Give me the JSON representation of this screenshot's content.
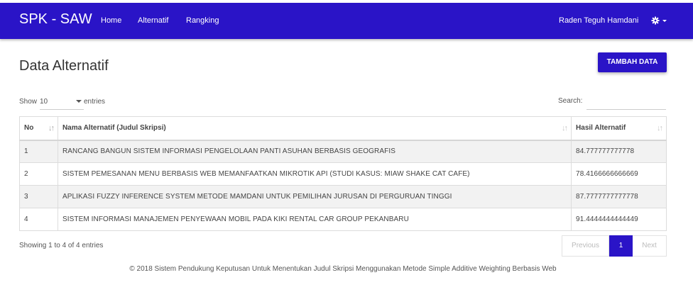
{
  "navbar": {
    "brand": "SPK - SAW",
    "links": [
      "Home",
      "Alternatif",
      "Rangking"
    ],
    "user": "Raden Teguh Hamdani",
    "settings_icon": "gear-icon",
    "color": "#2a14c7"
  },
  "page": {
    "title": "Data Alternatif",
    "add_button": "TAMBAH DATA"
  },
  "table_controls": {
    "show_label": "Show",
    "page_length": "10",
    "entries_label": "entries",
    "search_label": "Search:",
    "search_value": ""
  },
  "table": {
    "headers": [
      "No",
      "Nama Alternatif (Judul Skripsi)",
      "Hasil Alternatif"
    ],
    "rows": [
      [
        "1",
        "RANCANG BANGUN SISTEM INFORMASI PENGELOLAAN PANTI ASUHAN BERBASIS GEOGRAFIS",
        "84.777777777778"
      ],
      [
        "2",
        "SISTEM PEMESANAN MENU BERBASIS WEB MEMANFAATKAN MIKROTIK API (STUDI KASUS: MIAW SHAKE CAT CAFE)",
        "78.4166666666669"
      ],
      [
        "3",
        "APLIKASI FUZZY INFERENCE SYSTEM METODE MAMDANI UNTUK PEMILIHAN JURUSAN DI PERGURUAN TINGGI",
        "87.7777777777778"
      ],
      [
        "4",
        "SISTEM INFORMASI MANAJEMEN PENYEWAAN MOBIL PADA KIKI RENTAL CAR GROUP PEKANBARU",
        "91.4444444444449"
      ]
    ]
  },
  "pagination": {
    "info": "Showing 1 to 4 of 4 entries",
    "previous": "Previous",
    "current": "1",
    "next": "Next"
  },
  "footer": "© 2018 Sistem Pendukung Keputusan Untuk Menentukan Judul Skripsi Menggunakan Metode Simple Additive Weighting Berbasis Web"
}
